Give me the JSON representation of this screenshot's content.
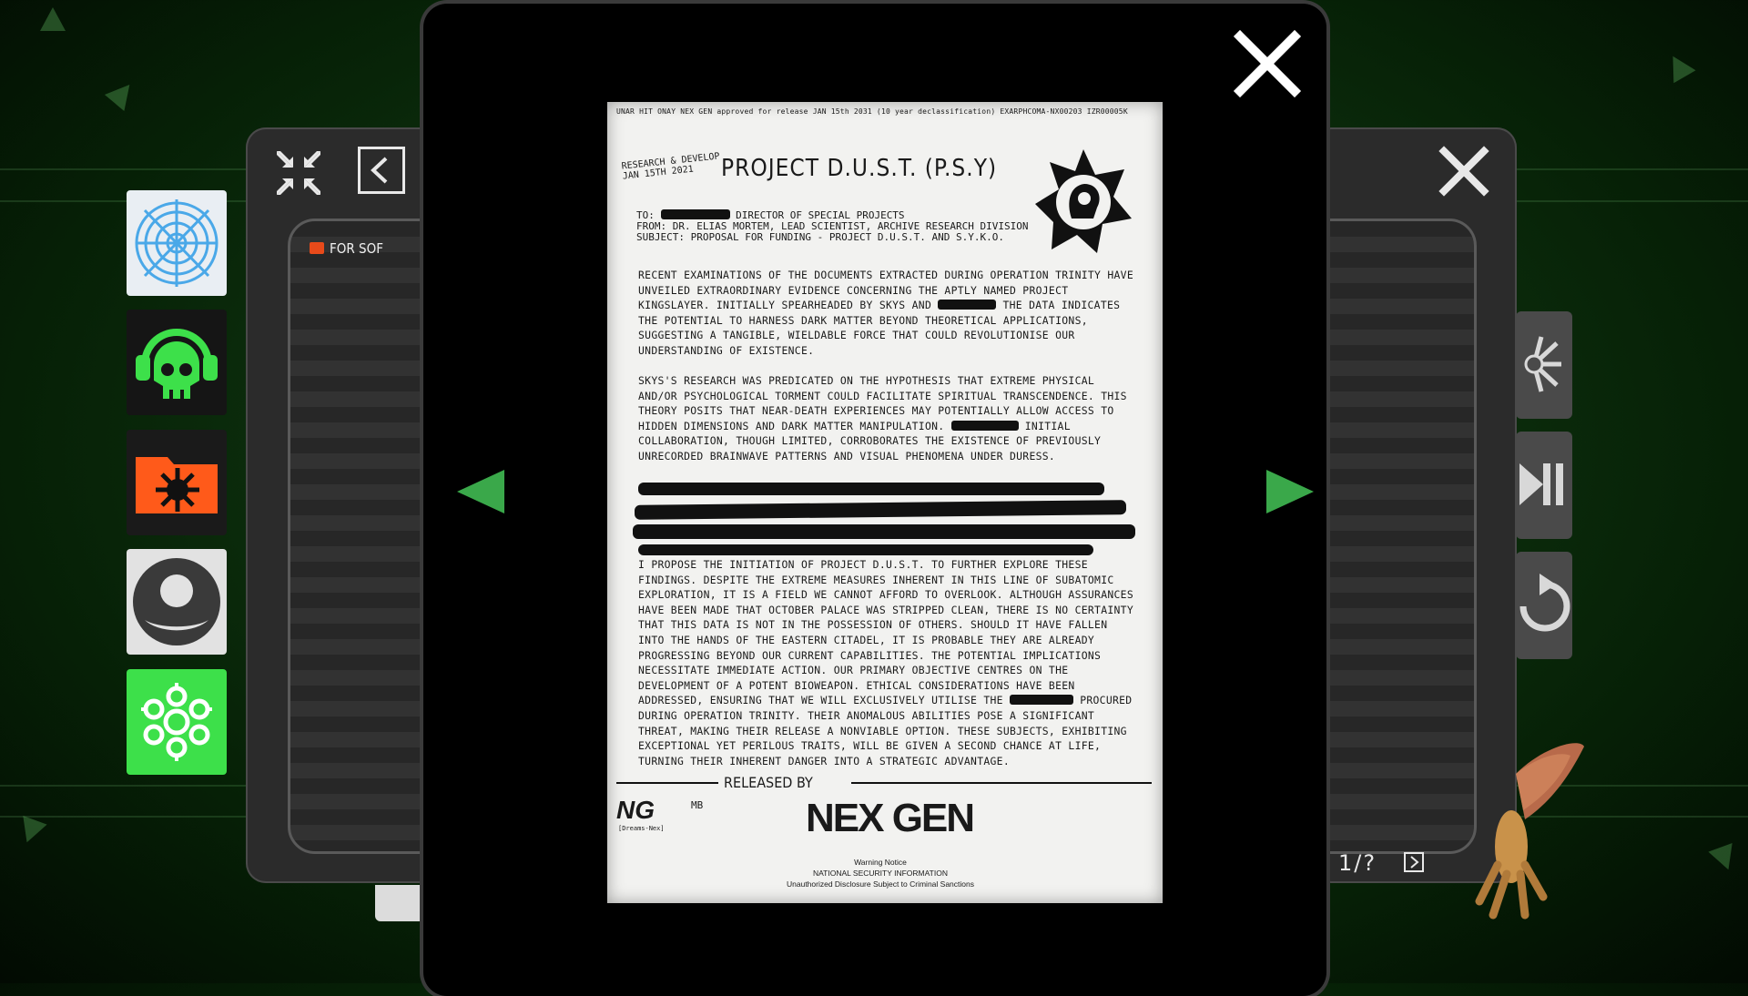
{
  "left_dock": {
    "icons": [
      {
        "name": "web-icon"
      },
      {
        "name": "skull-headphones-icon"
      },
      {
        "name": "virus-folder-icon"
      },
      {
        "name": "profile-icon"
      },
      {
        "name": "settings-flower-icon"
      }
    ]
  },
  "file_window": {
    "folder_label": "FOR SOF",
    "pagination": "1/?"
  },
  "document": {
    "header_line": "UNAR HIT ONAY     NEX GEN approved for release JAN 15th 2031 (10 year declassification) EXARPHCOMA-NX00203 IZR00005K",
    "stamp_line1": "RESEARCH & DEVELOP",
    "stamp_line2": "JAN 15TH 2021",
    "title": "PROJECT D.U.S.T. (P.S.Y)",
    "memo_to_suffix": "DIRECTOR OF SPECIAL PROJECTS",
    "memo_from": "FROM: DR. ELIAS MORTEM, LEAD SCIENTIST, ARCHIVE RESEARCH DIVISION",
    "memo_subject": "SUBJECT: PROPOSAL FOR FUNDING - PROJECT D.U.S.T. AND S.Y.K.O.",
    "para1_a": "Recent examinations of the documents extracted during Operation Trinity have unveiled extraordinary evidence concerning the aptly named Project Kingslayer. Initially spearheaded by Skys and",
    "para1_b": "the data indicates the potential to harness dark matter beyond theoretical applications, suggesting a tangible, wieldable force that could revolutionise our understanding of existence.",
    "para2_a": "Skys's research was predicated on the hypothesis that extreme physical and/or psychological torment could facilitate spiritual transcendence. This theory posits that near-death experiences may potentially allow access to hidden dimensions and dark matter manipulation.",
    "para2_b": "initial collaboration, though limited, corroborates the existence of previously unrecorded brainwave patterns and visual phenomena under duress.",
    "para3_a": "I propose the initiation of Project D.U.S.T. to further explore these findings. Despite the extreme measures inherent in this line of subatomic exploration, it is a field we cannot afford to overlook. Although assurances have been made that October Palace was stripped clean, there is no certainty that this data is not in the possession of others. Should it have fallen into the hands of the Eastern Citadel, it is probable they are already progressing beyond our current capabilities. The potential implications necessitate immediate action. Our primary objective centres on the development of a potent bioweapon. Ethical considerations have been addressed, ensuring that we will exclusively utilise the",
    "para3_b": "procured during Operation Trinity. Their anomalous abilities pose a significant threat, making their release a nonviable option. These subjects, exhibiting exceptional yet perilous traits, will be given a second chance at life, turning their inherent danger into a strategic advantage.",
    "released_by": "RELEASED BY",
    "ng_logo": "NG",
    "ng_sub": "[Dreams-Nex]",
    "mb_logo": "MB",
    "nexgen_logo": "NEX GEN",
    "warning_title": "Warning Notice",
    "warning_line1": "NATIONAL SECURITY INFORMATION",
    "warning_line2": "Unauthorized Disclosure Subject to Criminal Sanctions"
  },
  "colors": {
    "accent_green": "#3aa84a",
    "folder_orange": "#e84a1a",
    "icon_green": "#3de04a"
  }
}
